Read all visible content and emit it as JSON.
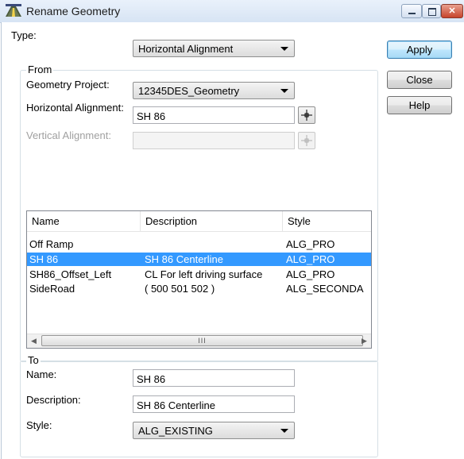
{
  "window": {
    "title": "Rename Geometry"
  },
  "type_row": {
    "label": "Type:",
    "value": "Horizontal Alignment"
  },
  "from_group": {
    "title": "From",
    "geometry_project": {
      "label": "Geometry Project:",
      "value": "12345DES_Geometry"
    },
    "horizontal_alignment": {
      "label": "Horizontal Alignment:",
      "value": "SH 86"
    },
    "vertical_alignment": {
      "label": "Vertical Alignment:",
      "value": ""
    }
  },
  "list": {
    "columns": [
      "Name",
      "Description",
      "Style"
    ],
    "rows": [
      {
        "name": "Off Ramp",
        "description": "",
        "style": "ALG_PRO",
        "selected": false
      },
      {
        "name": "SH 86",
        "description": "SH 86 Centerline",
        "style": "ALG_PRO",
        "selected": true
      },
      {
        "name": "SH86_Offset_Left",
        "description": "CL For left driving surface",
        "style": "ALG_PRO",
        "selected": false
      },
      {
        "name": "SideRoad",
        "description": "( 500 501 502 )",
        "style": "ALG_SECONDA",
        "selected": false
      }
    ],
    "scroll_grip": "III"
  },
  "to_group": {
    "title": "To",
    "name": {
      "label": "Name:",
      "value": "SH 86"
    },
    "description": {
      "label": "Description:",
      "value": "SH 86 Centerline"
    },
    "style": {
      "label": "Style:",
      "value": "ALG_EXISTING"
    }
  },
  "buttons": {
    "apply": "Apply",
    "close": "Close",
    "help": "Help"
  },
  "colors": {
    "selection": "#3399ff",
    "titlebar": "#dbe7f5",
    "close_button": "#c7432b"
  }
}
